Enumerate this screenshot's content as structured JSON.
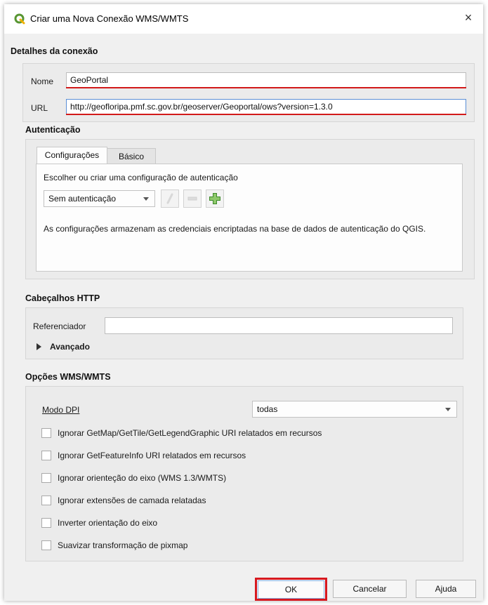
{
  "window": {
    "title": "Criar uma Nova Conexão WMS/WMTS",
    "close_glyph": "×"
  },
  "connection": {
    "section_title": "Detalhes da conexão",
    "name_label": "Nome",
    "name_value": "GeoPortal",
    "url_label": "URL",
    "url_value": "http://geofloripa.pmf.sc.gov.br/geoserver/Geoportal/ows?version=1.3.0"
  },
  "auth": {
    "section_title": "Autenticação",
    "tabs": [
      "Configurações",
      "Básico"
    ],
    "choose_label": "Escolher ou criar uma configuração de autenticação",
    "selected": "Sem autenticação",
    "info_text": "As configurações armazenam as credenciais encriptadas na base de dados de autenticação do QGIS."
  },
  "http": {
    "section_title": "Cabeçalhos HTTP",
    "referer_label": "Referenciador",
    "referer_value": "",
    "advanced_label": "Avançado"
  },
  "wms": {
    "section_title": "Opções WMS/WMTS",
    "dpi_label": "Modo DPI",
    "dpi_value": "todas",
    "checkboxes": [
      "Ignorar GetMap/GetTile/GetLegendGraphic URI relatados em recursos",
      "Ignorar GetFeatureInfo URI relatados em recursos",
      "Ignorar orienteção do eixo (WMS 1.3/WMTS)",
      "Ignorar extensões de camada relatadas",
      "Inverter orientação do eixo",
      "Suavizar transformação de pixmap"
    ]
  },
  "buttons": {
    "ok": "OK",
    "cancel": "Cancelar",
    "help": "Ajuda"
  },
  "colors": {
    "highlight_red": "#d71920",
    "qgis_green": "#589632"
  }
}
